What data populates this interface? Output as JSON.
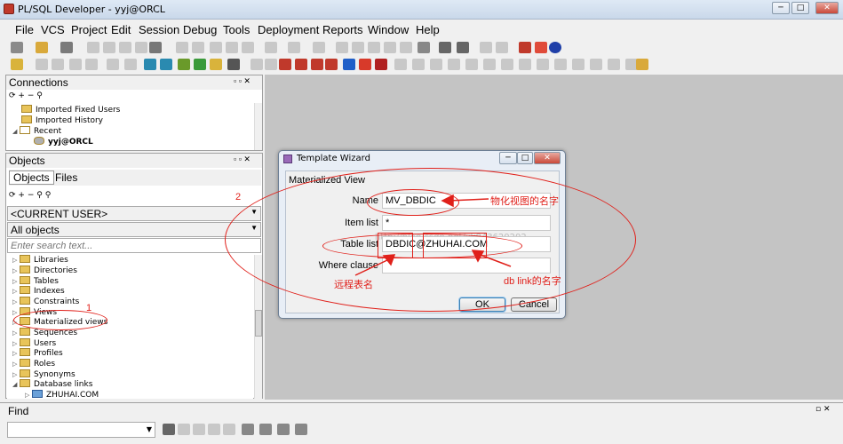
{
  "window": {
    "title": "PL/SQL Developer - yyj@ORCL",
    "minimize": "─",
    "maximize": "□",
    "close": "✕"
  },
  "menu": [
    "File",
    "VCS",
    "Project",
    "Edit",
    "Session",
    "Debug",
    "Tools",
    "Deployment",
    "Reports",
    "Window",
    "Help"
  ],
  "connections": {
    "title": "Connections",
    "items": [
      {
        "label": "Imported Fixed Users",
        "type": "folder"
      },
      {
        "label": "Imported History",
        "type": "folder"
      },
      {
        "label": "Recent",
        "type": "group"
      },
      {
        "label": "yyj@ORCL",
        "type": "db"
      }
    ]
  },
  "objects": {
    "title": "Objects",
    "tabs": [
      "Objects",
      "Files"
    ],
    "user_select": "<CURRENT USER>",
    "filter_select": "All objects",
    "search_placeholder": "Enter search text...",
    "tree": [
      "Libraries",
      "Directories",
      "Tables",
      "Indexes",
      "Constraints",
      "Views",
      "Materialized views",
      "Sequences",
      "Users",
      "Profiles",
      "Roles",
      "Synonyms",
      "Database links",
      "ZHUHAI.COM"
    ]
  },
  "dialog": {
    "title": "Template Wizard",
    "section": "Materialized View",
    "fields": {
      "name_label": "Name",
      "name_value": "MV_DBDIC",
      "item_list_label": "Item list",
      "item_list_value": "*",
      "table_list_label": "Table list",
      "table_list_value": "DBDIC@ZHUHAI.COM",
      "where_label": "Where clause",
      "where_value": ""
    },
    "ok": "OK",
    "cancel": "Cancel",
    "watermark": "http://blog.csdn.net/yk843620202"
  },
  "annotations": {
    "n1": "1",
    "n2": "2",
    "mv_name": "物化视图的名字",
    "remote_table": "远程表名",
    "dblink_name": "db link的名字"
  },
  "find": {
    "title": "Find"
  },
  "colors": {
    "annotation": "#e0201a",
    "workspace": "#c4c4c4"
  }
}
